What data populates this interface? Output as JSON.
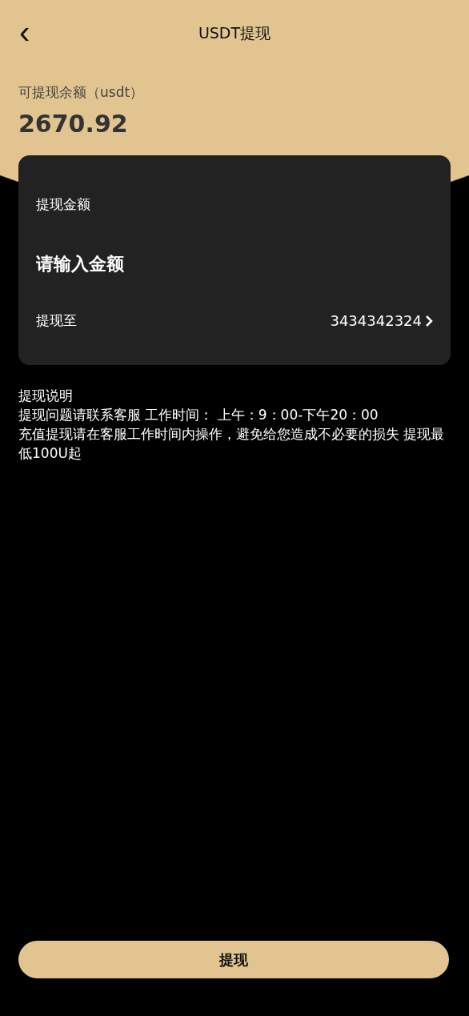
{
  "header": {
    "back": "‹",
    "title": "USDT提现"
  },
  "balance": {
    "label": "可提现余额（usdt）",
    "value": "2670.92"
  },
  "card": {
    "amount_label": "提现金额",
    "amount_placeholder": "请输入金额",
    "to_label": "提现至",
    "to_value": "3434342324"
  },
  "notes": {
    "title": "提现说明",
    "lines": [
      "提现问题请联系客服 工作时间： 上午：9：00-下午20：00",
      "充值提现请在客服工作时间内操作，避免给您造成不必要的损失 提现最低100U起"
    ]
  },
  "submit": "提现"
}
